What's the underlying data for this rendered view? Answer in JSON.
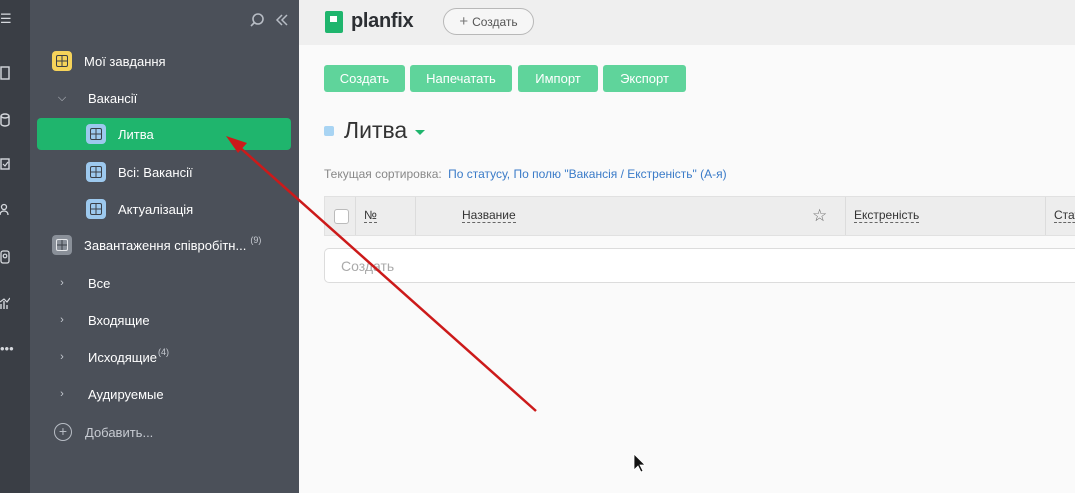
{
  "rail": {
    "icons": [
      "menu-icon",
      "document-icon",
      "database-icon",
      "task-icon",
      "people-icon",
      "contact-icon",
      "chart-icon",
      "more-icon"
    ]
  },
  "sidebar": {
    "items": [
      {
        "label": "Мої завдання",
        "icon": "grid-icon",
        "color": "#f6d35a"
      },
      {
        "label": "Вакансії"
      },
      {
        "label": "Литва",
        "icon": "grid-icon",
        "color": "#9dc9ee",
        "active": true
      },
      {
        "label": "Всі: Вакансії",
        "icon": "grid-icon",
        "color": "#9dc9ee"
      },
      {
        "label": "Актуалізація",
        "icon": "grid-icon",
        "color": "#9dc9ee"
      },
      {
        "label": "Завантаження співробітн...",
        "count": "(9)",
        "icon": "grid-icon",
        "color": "#8a9099"
      },
      {
        "label": "Все"
      },
      {
        "label": "Входящие"
      },
      {
        "label": "Исходящие",
        "count": "(4)"
      },
      {
        "label": "Аудируемые"
      }
    ],
    "add_label": "Добавить..."
  },
  "header": {
    "logo_text": "planfix",
    "create_label": "Создать"
  },
  "toolbar": {
    "create": "Создать",
    "print": "Напечатать",
    "import": "Импорт",
    "export": "Экспорт"
  },
  "page": {
    "title": "Литва",
    "sort_label": "Текущая сортировка:",
    "sort_value": "По статусу, По полю \"Вакансія / Екстреність\" (А-я)"
  },
  "table": {
    "columns": [
      "№",
      "Название",
      "Екстреність",
      "Стат"
    ],
    "create_placeholder": "Создать"
  },
  "colors": {
    "accent": "#1fb56d",
    "button": "#5fd49b",
    "sidebar": "#4b5059",
    "annotation_arrow": "#cc1a1a"
  }
}
